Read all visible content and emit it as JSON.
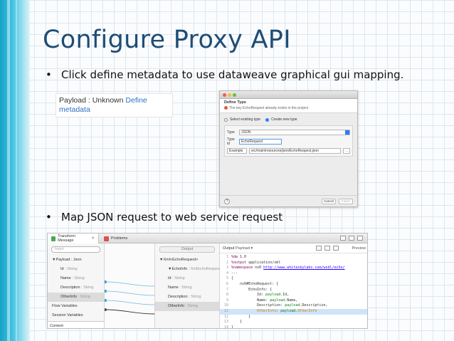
{
  "slide": {
    "title": "Configure Proxy API",
    "bullets": [
      "Click define metadata to use dataweave graphical gui mapping.",
      "Map JSON request to web service request"
    ],
    "bullet_char": "•",
    "colors": {
      "title": "#1d4d77",
      "accent_bar": "#16a3c8"
    }
  },
  "payload_snippet": {
    "text": "Payload : Unknown",
    "link_text": "Define",
    "link_text_2": "metadata"
  },
  "define_type_dialog": {
    "title": "Define Type",
    "warning": "The key EchoRequest already exists in the project",
    "radio_existing": "Select existing type",
    "radio_create": "Create new type",
    "type_label": "Type",
    "type_value": "JSON",
    "type_id_label": "Type id",
    "type_id_value": "EchoRequest",
    "source_label": "Example",
    "source_path": "src/main/resources/json/EchoRequest.json",
    "browse_label": "...",
    "help_label": "?",
    "cancel_label": "Cancel",
    "finish_label": "Finish"
  },
  "transform_panel": {
    "tabs": [
      {
        "label": "Transform Message",
        "active": true
      },
      {
        "label": "Problems",
        "active": false
      }
    ],
    "input": {
      "search_placeholder": "Input",
      "tree": [
        {
          "label": "▼Payload : Json",
          "child": false,
          "selected": false
        },
        {
          "label": "Id",
          "type": ": String",
          "child": true,
          "selected": false
        },
        {
          "label": "Name",
          "type": ": String",
          "child": true,
          "selected": false
        },
        {
          "label": "Description",
          "type": ": String",
          "child": true,
          "selected": false
        },
        {
          "label": "OtherInfo",
          "type": ": String",
          "child": true,
          "selected": true
        },
        {
          "label": "Flow Variables",
          "child": false,
          "selected": false
        },
        {
          "label": "Session Variables",
          "child": false,
          "selected": false
        }
      ],
      "footer_tab": "Context"
    },
    "output": {
      "header": "Output",
      "tree": [
        {
          "label": "▼Xml<EchoRequest>",
          "child": false,
          "selected": false
        },
        {
          "label": "▼EchoInfo",
          "type": ": XmlEchoRequest",
          "child": true,
          "selected": false
        },
        {
          "label": "Id",
          "type": ": String",
          "child": true,
          "selected": false
        },
        {
          "label": "Name",
          "type": ": String",
          "child": true,
          "selected": false
        },
        {
          "label": "Description",
          "type": ": String",
          "child": true,
          "selected": false
        },
        {
          "label": "OtherInfo",
          "type": ": String",
          "child": true,
          "selected": true
        }
      ]
    },
    "code": {
      "output_label": "Output",
      "output_value": "Payload ▾",
      "preview_label": "Preview",
      "lines": [
        {
          "n": "1",
          "html": "<span class=\"k\">%dw</span> 1.0"
        },
        {
          "n": "2",
          "html": "<span class=\"k\">%output</span> application/xml"
        },
        {
          "n": "3",
          "html": "<span class=\"k\">%namespace</span> ns0 <span class=\"u\">http://www.whiteskylabs.com/wsdl/echo/</span>"
        },
        {
          "n": "4",
          "html": "---"
        },
        {
          "n": "5",
          "html": "{"
        },
        {
          "n": "6",
          "html": "    ns0#EchoRequest: {"
        },
        {
          "n": "7",
          "html": "        EchoInfo: {"
        },
        {
          "n": "8",
          "html": "            Id: <span class=\"p\">payload</span>.Id,"
        },
        {
          "n": "9",
          "html": "            Name: <span class=\"p\">payload</span>.Name,"
        },
        {
          "n": "10",
          "html": "            Description: <span class=\"p\">payload</span>.Description,"
        },
        {
          "n": "11",
          "html": "            <span class=\"fx\">OtherInfo</span>: <span class=\"p\">payload</span>.<span class=\"fx\">OtherInfo</span>",
          "hl": true
        },
        {
          "n": "12",
          "html": "        }"
        },
        {
          "n": "13",
          "html": "    }"
        },
        {
          "n": "14",
          "html": "}"
        }
      ]
    }
  }
}
